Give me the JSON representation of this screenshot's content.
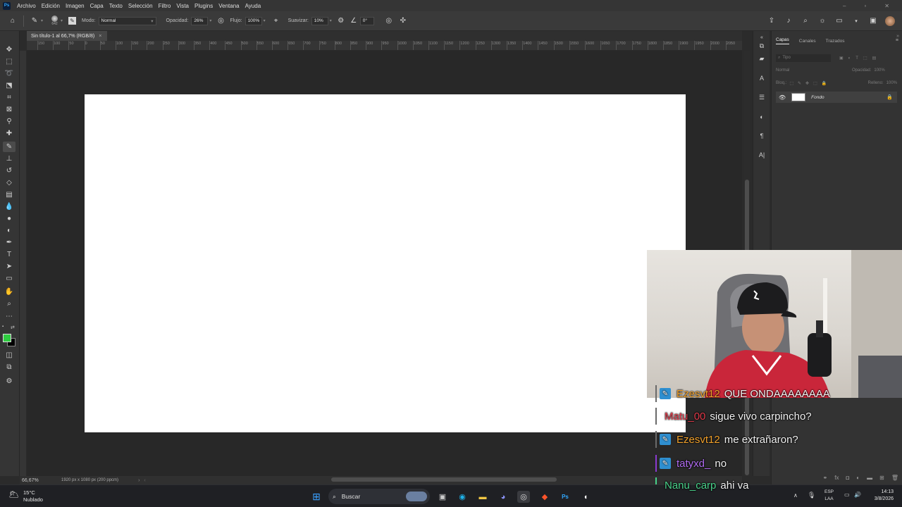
{
  "menubar": {
    "app_badge": "Ps",
    "items": [
      "Archivo",
      "Edición",
      "Imagen",
      "Capa",
      "Texto",
      "Selección",
      "Filtro",
      "Vista",
      "Plugins",
      "Ventana",
      "Ayuda"
    ],
    "window_controls": [
      "–",
      "▫",
      "✕"
    ]
  },
  "options": {
    "brush_size": "642",
    "mode_label": "Modo:",
    "mode_value": "Normal",
    "opacity_label": "Opacidad:",
    "opacity_value": "26%",
    "flow_label": "Flujo:",
    "flow_value": "100%",
    "smoothing_label": "Suavizar:",
    "smoothing_value": "10%",
    "angle_value": "0°"
  },
  "document": {
    "tab_title": "Sin título-1 al 66,7% (RGB/8)",
    "tab_close": "×",
    "zoom": "66,67%",
    "info": "1920 px x 1080 px (200 ppcm)",
    "ruler_ticks": [
      "150",
      "100",
      "50",
      "0",
      "50",
      "100",
      "150",
      "200",
      "250",
      "300",
      "350",
      "400",
      "450",
      "500",
      "550",
      "600",
      "650",
      "700",
      "750",
      "800",
      "850",
      "900",
      "950",
      "1000",
      "1050",
      "1100",
      "1150",
      "1200",
      "1250",
      "1300",
      "1350",
      "1400",
      "1450",
      "1500",
      "1550",
      "1600",
      "1650",
      "1700",
      "1750",
      "1800",
      "1850",
      "1900",
      "1950",
      "2000",
      "2050"
    ]
  },
  "colors": {
    "foreground": "#2ecc40",
    "background": "#000000",
    "canvas": "#ffffff",
    "accent": "#31a8ff"
  },
  "layers_panel": {
    "tabs": [
      "Capas",
      "Canales",
      "Trazados"
    ],
    "search_placeholder": "Tipo",
    "blend_mode": "Normal",
    "opacity_label": "Opacidad:",
    "opacity_value": "100%",
    "lock_label": "Bloq.:",
    "fill_label": "Relleno:",
    "fill_value": "100%",
    "layer_name": "Fondo"
  },
  "chat": [
    {
      "user": "Ezesvt12",
      "message": "QUE ONDAAAAAAAA",
      "color": "#f0a02b",
      "badge": "#2f8fd0",
      "bar": "#6a6a6a"
    },
    {
      "user": "Matu_00",
      "message": "sigue vivo carpincho?",
      "color": "#e03a4a",
      "badge": "",
      "bar": "#6a6a6a"
    },
    {
      "user": "Ezesvt12",
      "message": "me extrañaron?",
      "color": "#f0a02b",
      "badge": "#2f8fd0",
      "bar": "#6a6a6a"
    },
    {
      "user": "tatyxd_",
      "message": "no",
      "color": "#b06bf0",
      "badge": "#2f8fd0",
      "bar": "#8a3ad0"
    },
    {
      "user": "Nanu_carp",
      "message": "ahi va",
      "color": "#49d18a",
      "badge": "",
      "bar": "#49d18a"
    }
  ],
  "taskbar": {
    "weather_temp": "15°C",
    "weather_desc": "Nublado",
    "search_label": "Buscar",
    "lang_top": "ESP",
    "lang_bottom": "LAA",
    "time": "14:13",
    "date": "3/8/2026"
  }
}
